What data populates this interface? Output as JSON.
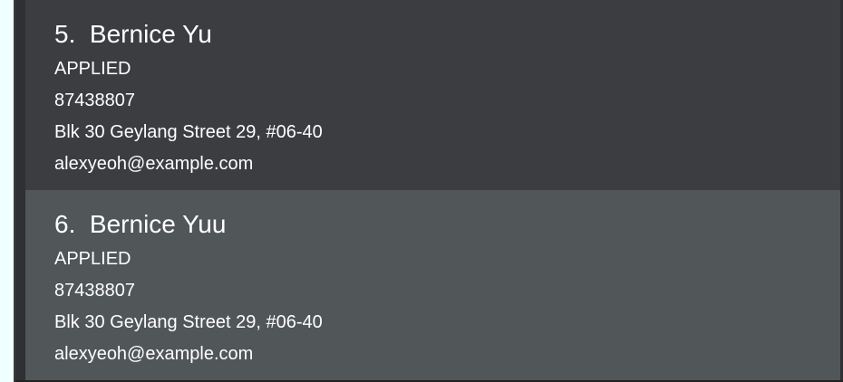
{
  "cards": [
    {
      "index": "5.",
      "name": "Bernice Yu",
      "status": "APPLIED",
      "phone": "87438807",
      "address": "Blk 30 Geylang Street 29, #06-40",
      "email": "alexyeoh@example.com"
    },
    {
      "index": "6.",
      "name": "Bernice Yuu",
      "status": "APPLIED",
      "phone": "87438807",
      "address": "Blk 30 Geylang Street 29, #06-40",
      "email": "alexyeoh@example.com"
    }
  ],
  "colors": {
    "background": "#f0ffff",
    "card_default": "#3c3d40",
    "card_selected": "#515658",
    "text": "#ffffff"
  }
}
